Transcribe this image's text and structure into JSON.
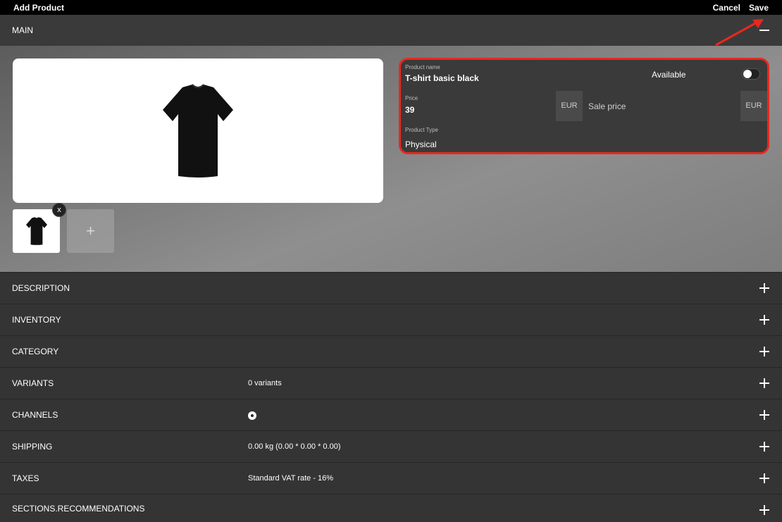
{
  "topbar": {
    "title": "Add Product",
    "cancel_label": "Cancel",
    "save_label": "Save"
  },
  "main": {
    "header": "MAIN",
    "thumb_remove": "x",
    "add_image": "+",
    "form": {
      "product_name_label": "Product name",
      "product_name_value": "T-shirt basic black",
      "available_label": "Available",
      "available": false,
      "price_label": "Price",
      "price_value": "39",
      "currency": "EUR",
      "sale_price_placeholder": "Sale price",
      "sale_currency": "EUR",
      "product_type_label": "Product Type",
      "product_type_value": "Physical"
    }
  },
  "sections": [
    {
      "name": "DESCRIPTION",
      "value": ""
    },
    {
      "name": "INVENTORY",
      "value": ""
    },
    {
      "name": "CATEGORY",
      "value": ""
    },
    {
      "name": "VARIANTS",
      "value": "0 variants"
    },
    {
      "name": "CHANNELS",
      "value": ""
    },
    {
      "name": "SHIPPING",
      "value": "0.00 kg (0.00 * 0.00 * 0.00)"
    },
    {
      "name": "TAXES",
      "value": "Standard VAT rate - 16%"
    },
    {
      "name": "SECTIONS.RECOMMENDATIONS",
      "value": ""
    }
  ],
  "colors": {
    "highlight": "#e8281e",
    "background": "#343434",
    "topbar": "#000000"
  },
  "icons": {
    "collapse": "minus-icon",
    "expand": "plus-icon",
    "channel": "radio-icon",
    "annotation": "red-arrow-icon"
  }
}
